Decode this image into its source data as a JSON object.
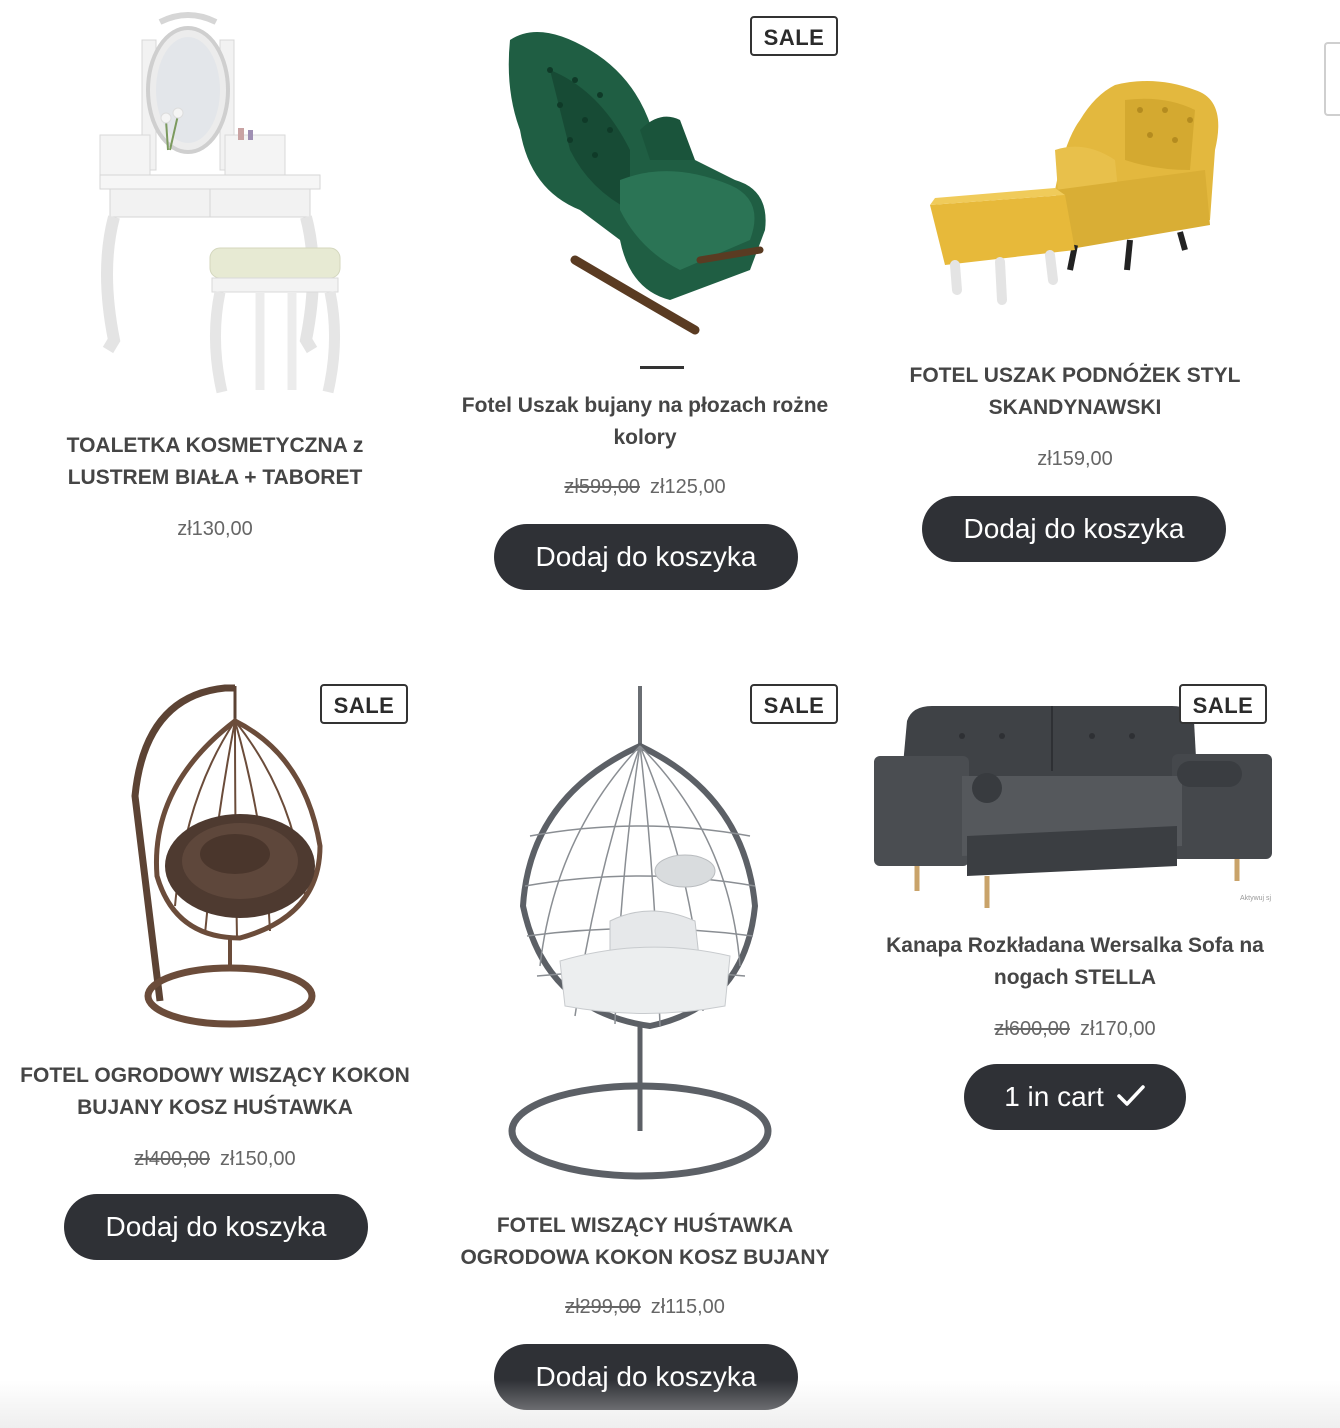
{
  "labels": {
    "sale": "SALE",
    "add_to_cart": "Dodaj do koszyka",
    "in_cart": "1 in cart"
  },
  "products": [
    {
      "title": "TOALETKA KOSMETYCZNA z LUSTREM BIAŁA + TABORET",
      "price": "zł130,00",
      "on_sale": false
    },
    {
      "title": "Fotel Uszak bujany na płozach rożne kolory",
      "old_price": "zł599,00",
      "price": "zł125,00",
      "on_sale": true,
      "button": "Dodaj do koszyka"
    },
    {
      "title": "FOTEL USZAK PODNÓŻEK STYL SKANDYNAWSKI",
      "price": "zł159,00",
      "on_sale": false,
      "button": "Dodaj do koszyka"
    },
    {
      "title": "FOTEL OGRODOWY WISZĄCY KOKON BUJANY KOSZ HUŚTAWKA",
      "old_price": "zł400,00",
      "price": "zł150,00",
      "on_sale": true,
      "button": "Dodaj do koszyka"
    },
    {
      "title": "FOTEL WISZĄCY HUŚTAWKA OGRODOWA KOKON KOSZ BUJANY",
      "old_price": "zł299,00",
      "price": "zł115,00",
      "on_sale": true,
      "button": "Dodaj do koszyka"
    },
    {
      "title": "Kanapa Rozkładana Wersalka Sofa na nogach STELLA",
      "old_price": "zł600,00",
      "price": "zł170,00",
      "on_sale": true,
      "button": "1 in cart",
      "in_cart": true
    }
  ],
  "watermark": "Aktywuj sj"
}
